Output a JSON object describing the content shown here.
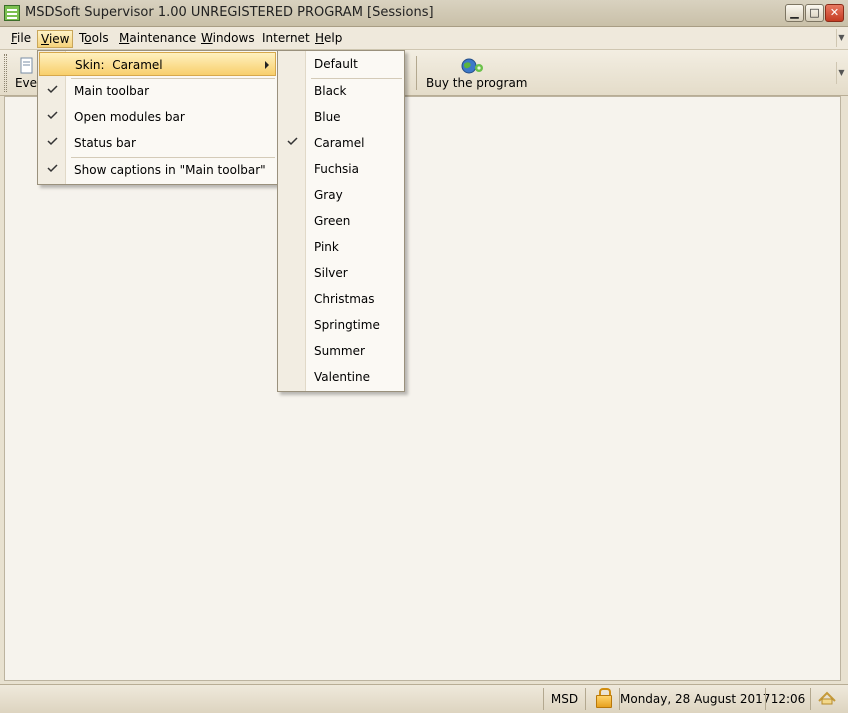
{
  "window": {
    "title": "MSDSoft Supervisor 1.00 UNREGISTERED PROGRAM [Sessions]",
    "buttons": {
      "minimize": "▁",
      "maximize": "□",
      "close": "✕"
    }
  },
  "menubar": {
    "items": [
      {
        "key": "F",
        "rest": "ile"
      },
      {
        "key": "V",
        "rest": "iew"
      },
      {
        "pre": "T",
        "key": "o",
        "rest": "ols"
      },
      {
        "key": "M",
        "rest": "aintenance"
      },
      {
        "key": "W",
        "rest": "indows"
      },
      {
        "pre": "",
        "key": "",
        "rest": "Internet"
      },
      {
        "key": "H",
        "rest": "elp"
      }
    ]
  },
  "toolbar": {
    "first_button_partial": "Eve",
    "buy_label": "Buy the program"
  },
  "view_menu": {
    "skin_label": "Skin:",
    "skin_value": "Caramel",
    "items": [
      {
        "label": "Main toolbar",
        "checked": true
      },
      {
        "label": "Open modules bar",
        "checked": true
      },
      {
        "label": "Status bar",
        "checked": true
      },
      {
        "label": "Show captions in \"Main toolbar\"",
        "checked": true
      }
    ]
  },
  "skin_menu": {
    "default": "Default",
    "items": [
      "Black",
      "Blue",
      "Caramel",
      "Fuchsia",
      "Gray",
      "Green",
      "Pink",
      "Silver",
      "Christmas",
      "Springtime",
      "Summer",
      "Valentine"
    ],
    "checked": "Caramel"
  },
  "statusbar": {
    "user": "MSD",
    "date": "Monday, 28 August 2017",
    "time": "12:06"
  },
  "colors": {
    "highlight": "#f8cf6c",
    "accent": "#c43b22"
  }
}
